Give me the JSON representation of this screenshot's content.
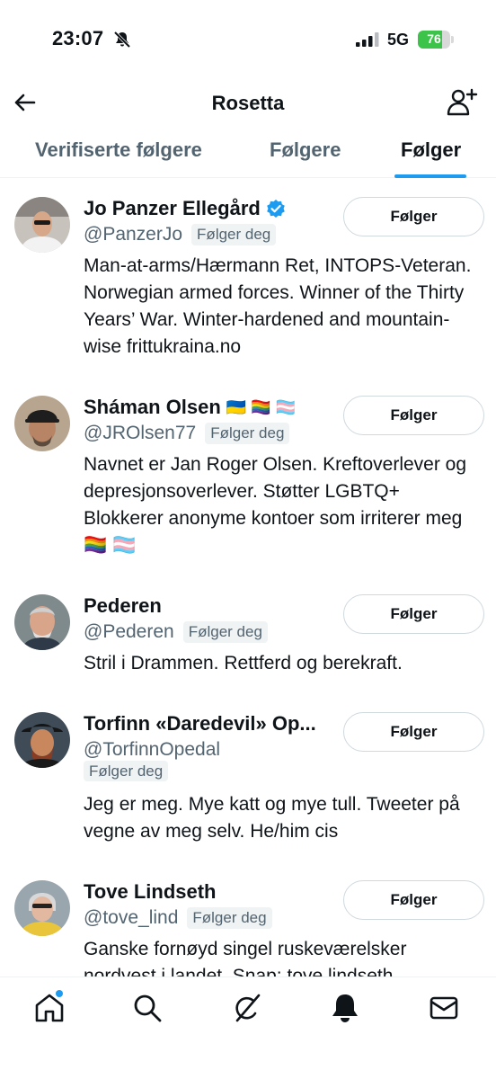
{
  "status_bar": {
    "time": "23:07",
    "network": "5G",
    "battery_text": "76",
    "battery_level": 0.76,
    "icons": [
      "bell-slash-icon",
      "signal-icon",
      "battery-icon"
    ]
  },
  "header": {
    "title": "Rosetta",
    "back_icon": "arrow-left-icon",
    "add_user_icon": "add-user-icon"
  },
  "tabs": [
    {
      "label": "Verifiserte følgere",
      "active": false
    },
    {
      "label": "Følgere",
      "active": false
    },
    {
      "label": "Følger",
      "active": true
    }
  ],
  "users": [
    {
      "name": "Jo Panzer Ellegård",
      "verified": true,
      "handle": "@PanzerJo",
      "follows_you": "Følger deg",
      "bio": "Man-at-arms/Hærmann Ret, INTOPS-Veteran. Norwegian armed forces. Winner of the Thirty Years’ War. Winter-hardened and mountain-wise frittukraina.no",
      "button": "Følger"
    },
    {
      "name": "Sháman Olsen",
      "flags": "🇺🇦 🏳️‍🌈 🏳️‍⚧️",
      "handle": "@JROlsen77",
      "follows_you": "Følger deg",
      "bio": "Navnet er Jan Roger Olsen. Kreftoverlever og depresjonsoverlever. Støtter LGBTQ+ Blokkerer anonyme kontoer som irriterer meg 🏳️‍🌈 🏳️‍⚧️",
      "button": "Følger"
    },
    {
      "name": "Pederen",
      "handle": "@Pederen",
      "follows_you": "Følger deg",
      "bio": "Stril i Drammen. Rettferd og berekraft.",
      "button": "Følger"
    },
    {
      "name": "Torfinn «Daredevil» Op...",
      "handle": "@TorfinnOpedal",
      "follows_you": "Følger deg",
      "bio": "Jeg er meg. Mye katt og mye tull. Tweeter på vegne av meg selv. He/him cis",
      "button": "Følger"
    },
    {
      "name": "Tove Lindseth",
      "handle": "@tove_lind",
      "follows_you": "Følger deg",
      "bio": "Ganske fornøyd singel ruskeværelsker nordvest i landet. Snap: tove.lindseth",
      "button": "Følger"
    }
  ],
  "bottom_nav": [
    "home-icon",
    "search-icon",
    "grok-icon",
    "notifications-icon",
    "messages-icon"
  ],
  "colors": {
    "accent": "#1d9bf0",
    "text": "#0f1419",
    "secondary_text": "#536471",
    "battery_green": "#3bc34a"
  }
}
